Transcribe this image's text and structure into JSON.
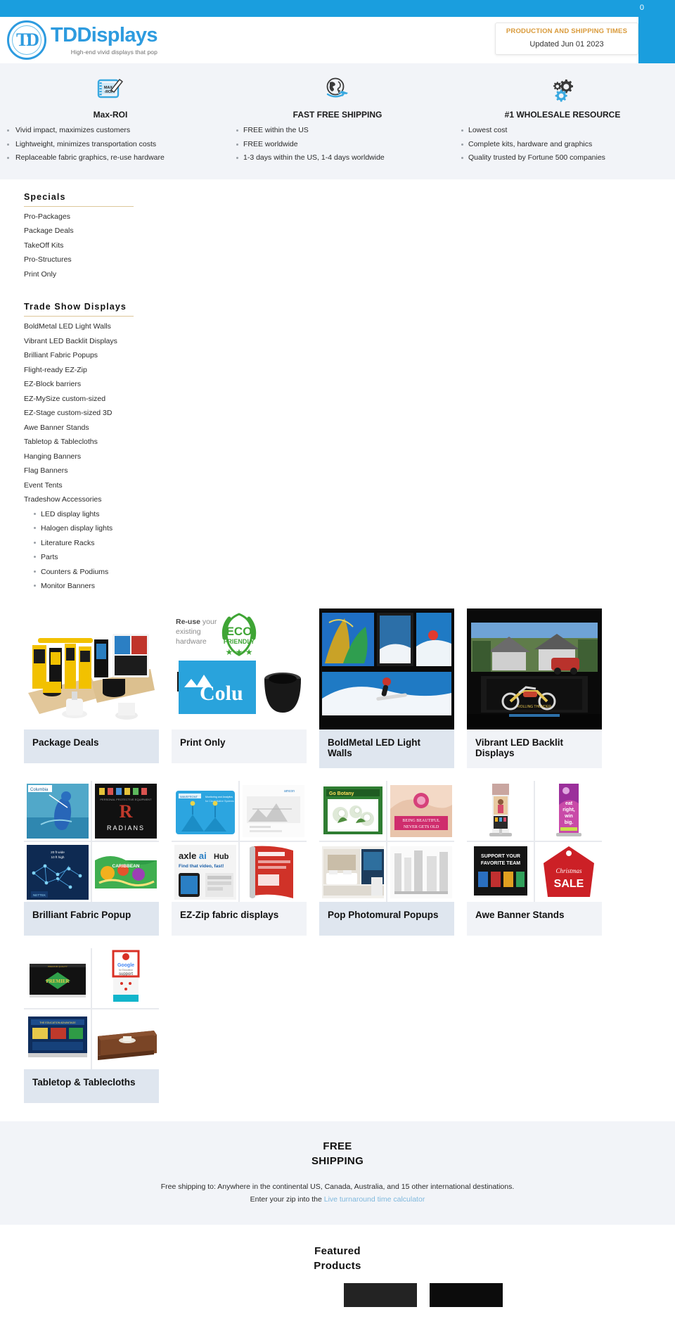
{
  "topbar": {
    "cart_count": "0"
  },
  "header": {
    "logo_initials": "TD",
    "logo_title": "TDDisplays",
    "logo_tagline": "High-end vivid displays that pop",
    "production_box": {
      "title": "PRODUCTION AND SHIPPING TIMES",
      "updated": "Updated Jun 01 2023"
    }
  },
  "features": [
    {
      "icon": "notepad-pencil-icon",
      "icon_label": "MAX\n-ROI",
      "title": "Max-ROI",
      "items": [
        "Vivid impact, maximizes customers",
        "Lightweight, minimizes transportation costs",
        "Replaceable fabric graphics, re-use hardware"
      ]
    },
    {
      "icon": "globe-airplane-icon",
      "title": "FAST FREE SHIPPING",
      "items": [
        "FREE within the US",
        "FREE worldwide",
        "1-3 days within the US, 1-4 days worldwide"
      ]
    },
    {
      "icon": "gears-icon",
      "title": "#1 WHOLESALE RESOURCE",
      "items": [
        "Lowest cost",
        "Complete kits, hardware and graphics",
        "Quality trusted by Fortune 500 companies"
      ]
    }
  ],
  "nav": [
    {
      "heading": "Specials",
      "items": [
        "Pro-Packages",
        "Package Deals",
        "TakeOff Kits",
        "Pro-Structures",
        "Print Only"
      ],
      "sub_items": []
    },
    {
      "heading": "Trade Show Displays",
      "items": [
        "BoldMetal LED Light Walls",
        "Vibrant LED Backlit Displays",
        "Brilliant Fabric Popups",
        "Flight-ready EZ-Zip",
        "EZ-Block barriers",
        "EZ-MySize custom-sized",
        "EZ-Stage custom-sized 3D",
        "Awe Banner Stands",
        "Tabletop & Tablecloths",
        "Hanging Banners",
        "Flag Banners",
        "Event Tents",
        "Tradeshow Accessories"
      ],
      "sub_items": [
        "LED display lights",
        "Halogen display lights",
        "Literature Racks",
        "Parts",
        "Counters & Podiums",
        "Monitor Banners"
      ]
    }
  ],
  "cards": [
    {
      "label": "Package Deals",
      "cap_style": "cap-blue",
      "image": "tradeshow-booth-collage"
    },
    {
      "label": "Print Only",
      "cap_style": "cap-gray",
      "image": "eco-friendly-reuse-graphics"
    },
    {
      "label": "BoldMetal LED Light Walls",
      "cap_style": "cap-blue",
      "image": "led-light-wall-panels"
    },
    {
      "label": "Vibrant LED Backlit Displays",
      "cap_style": "cap-gray",
      "image": "backlit-motorcycle-display"
    },
    {
      "label": "Brilliant Fabric Popup",
      "cap_style": "cap-blue",
      "image": "fabric-popup-grid"
    },
    {
      "label": "EZ-Zip fabric displays",
      "cap_style": "cap-gray",
      "image": "ez-zip-fabric-grid"
    },
    {
      "label": "Pop Photomural Popups",
      "cap_style": "cap-blue",
      "image": "photomural-popup-grid"
    },
    {
      "label": "Awe Banner Stands",
      "cap_style": "cap-gray",
      "image": "banner-stands-grid"
    },
    {
      "label": "Tabletop & Tablecloths",
      "cap_style": "cap-blue",
      "image": "tabletop-tablecloth-grid"
    }
  ],
  "shipping": {
    "title_line1": "FREE",
    "title_line2": "SHIPPING",
    "body": "Free shipping to: Anywhere in the continental US, Canada, Australia, and 15 other international destinations.",
    "prefix": "Enter your zip into the ",
    "link": "Live turnaround time calculator"
  },
  "featured": {
    "title_line1": "Featured",
    "title_line2": "Products"
  },
  "colors": {
    "brand_blue": "#1a9ede",
    "accent_gold": "#d99a3a",
    "band_gray": "#f2f4f8",
    "caption_blue": "#dfe6ef",
    "link_blue": "#7fb8dd"
  }
}
